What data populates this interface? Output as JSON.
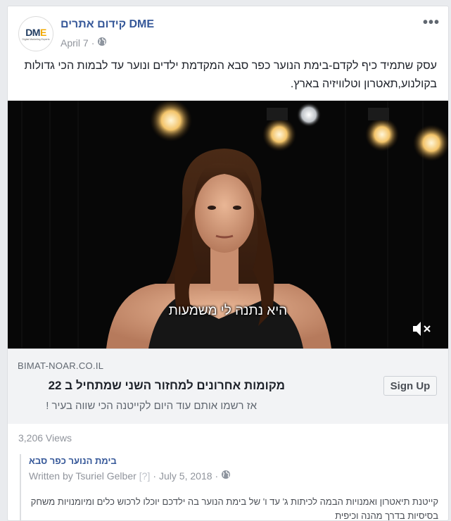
{
  "post": {
    "page_name": "קידום אתרים DME",
    "date": "April 7",
    "dot": "·",
    "more": "•••",
    "text": "עסק שתמיד כיף לקדם-בימת הנוער כפר סבא המקדמת ילדים ונוער עד לבמות הכי גדולות בקולנוע,תאטרון וטלוויזיה בארץ."
  },
  "avatar": {
    "logo_main": "DM",
    "logo_accent": "E",
    "logo_tagline": "Digital Marketing Experts"
  },
  "video": {
    "subtitle": "היא נתנה לי משמעות",
    "muted": true
  },
  "link_preview": {
    "domain": "BIMAT-NOAR.CO.IL",
    "headline": "מקומות אחרונים למחזור השני שמתחיל ב 22",
    "description": "אז רשמו אותם עוד היום לקייטנה הכי שווה בעיר !",
    "cta_label": "Sign Up"
  },
  "stats": {
    "views": "3,206 Views"
  },
  "shared": {
    "page_name": "בימת הנוער כפר סבא",
    "written_by": "Written by Tsuriel Gelber",
    "help_mark": "[?]",
    "dot": "·",
    "date": "July 5, 2018",
    "dot2": "·",
    "text": "קייטנת תיאטרון ואמנויות הבמה לכיתות ג' עד ו' של בימת הנוער בה ילדכם יוכלו לרכוש כלים ומיומנויות משחק בסיסיות בדרך מהנה וכיפית"
  },
  "colors": {
    "link_blue": "#365899",
    "muted_gray": "#90949c",
    "bg": "#e9ebee"
  },
  "icons": [
    "globe-icon",
    "mute-icon",
    "more-icon"
  ]
}
